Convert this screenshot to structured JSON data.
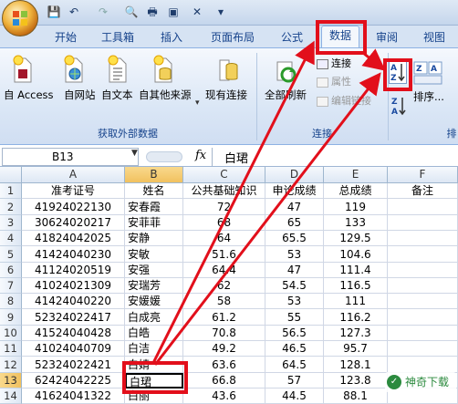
{
  "qat": {
    "save": "💾",
    "undo": "↶",
    "redo": "↷",
    "print_preview": "🔍",
    "print": "🖶",
    "image": "▣",
    "more": "▾"
  },
  "tabs": [
    "开始",
    "工具箱",
    "插入",
    "页面布局",
    "公式",
    "数据",
    "审阅",
    "视图"
  ],
  "ribbon": {
    "external_data": {
      "items": [
        "自 Access",
        "自网站",
        "自文本",
        "自其他来源",
        "现有连接"
      ],
      "group_label": "获取外部数据"
    },
    "connections": {
      "refresh_label": "全部刷新",
      "items": [
        "连接",
        "属性",
        "编辑链接"
      ],
      "group_label": "连接"
    },
    "sort": {
      "sort_label": "排序...",
      "group_label_partial": "排"
    }
  },
  "formula_bar": {
    "name_box": "B13",
    "fx": "fx",
    "value": "白珺"
  },
  "columns": [
    "A",
    "B",
    "C",
    "D",
    "E",
    "F"
  ],
  "headers": [
    "准考证号",
    "姓名",
    "公共基础知识",
    "申论成绩",
    "总成绩",
    "备注"
  ],
  "rows": [
    {
      "n": "1",
      "cells": [
        "准考证号",
        "姓名",
        "公共基础知识",
        "申论成绩",
        "总成绩",
        "备注"
      ]
    },
    {
      "n": "2",
      "cells": [
        "41924022130",
        "安春霞",
        "72",
        "47",
        "119",
        ""
      ]
    },
    {
      "n": "3",
      "cells": [
        "30624020217",
        "安菲菲",
        "68",
        "65",
        "133",
        ""
      ]
    },
    {
      "n": "4",
      "cells": [
        "41824042025",
        "安静",
        "64",
        "65.5",
        "129.5",
        ""
      ]
    },
    {
      "n": "5",
      "cells": [
        "41424040230",
        "安敏",
        "51.6",
        "53",
        "104.6",
        ""
      ]
    },
    {
      "n": "6",
      "cells": [
        "41124020519",
        "安强",
        "64.4",
        "47",
        "111.4",
        ""
      ]
    },
    {
      "n": "7",
      "cells": [
        "41024021309",
        "安瑞芳",
        "62",
        "54.5",
        "116.5",
        ""
      ]
    },
    {
      "n": "8",
      "cells": [
        "41424040220",
        "安媛媛",
        "58",
        "53",
        "111",
        ""
      ]
    },
    {
      "n": "9",
      "cells": [
        "52324022417",
        "白成亮",
        "61.2",
        "55",
        "116.2",
        ""
      ]
    },
    {
      "n": "10",
      "cells": [
        "41524040428",
        "白皓",
        "70.8",
        "56.5",
        "127.3",
        ""
      ]
    },
    {
      "n": "11",
      "cells": [
        "41024040709",
        "白洁",
        "49.2",
        "46.5",
        "95.7",
        ""
      ]
    },
    {
      "n": "12",
      "cells": [
        "52324022421",
        "白婧",
        "63.6",
        "64.5",
        "128.1",
        ""
      ]
    },
    {
      "n": "13",
      "cells": [
        "62424042225",
        "白珺",
        "66.8",
        "57",
        "123.8",
        ""
      ]
    },
    {
      "n": "14",
      "cells": [
        "41624041322",
        "白丽",
        "43.6",
        "44.5",
        "88.1",
        ""
      ]
    }
  ],
  "watermark": "神奇下载",
  "colors": {
    "accent_red": "#e20f1b",
    "ribbon_text": "#15428b"
  }
}
